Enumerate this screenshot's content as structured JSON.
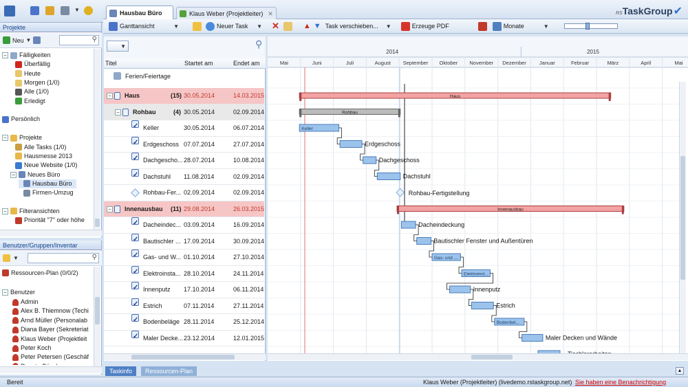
{
  "tabs": [
    {
      "label": "Hausbau Büro",
      "active": true
    },
    {
      "label": "Klaus Weber (Projektleiter)",
      "active": false
    }
  ],
  "brand": {
    "prefix": "RS",
    "name": "TaskGroup"
  },
  "toolbar": {
    "gantt_view": "Ganttansicht",
    "new_task": "Neuer Task",
    "move_task": "Task verschieben...",
    "pdf": "Erzeuge PDF",
    "scale": "Monate"
  },
  "left": {
    "projects_title": "Projekte",
    "new_label": "Neu",
    "tree": [
      {
        "label": "Fälligkeiten",
        "level": 0,
        "exp": "−",
        "icon": "calendar-icon"
      },
      {
        "label": "Überfällig",
        "level": 1,
        "icon": "exclamation-icon"
      },
      {
        "label": "Heute",
        "level": 1,
        "icon": "day-icon"
      },
      {
        "label": "Morgen (1/0)",
        "level": 1,
        "icon": "day-icon"
      },
      {
        "label": "Alle (1/0)",
        "level": 1,
        "icon": "sigma-icon"
      },
      {
        "label": "Erledigt",
        "level": 1,
        "icon": "check-icon"
      },
      {
        "label": "",
        "level": 0
      },
      {
        "label": "Persönlich",
        "level": 0,
        "icon": "person-icon"
      },
      {
        "label": "",
        "level": 0
      },
      {
        "label": "Projekte",
        "level": 0,
        "exp": "−",
        "icon": "folder-icon"
      },
      {
        "label": "Alle Tasks (1/0)",
        "level": 1,
        "icon": "tasks-icon"
      },
      {
        "label": "Hausmesse 2013",
        "level": 1,
        "icon": "folder-icon"
      },
      {
        "label": "Neue Website (1/0)",
        "level": 1,
        "icon": "globe-icon"
      },
      {
        "label": "Neues Büro",
        "level": 1,
        "exp": "−",
        "icon": "building-icon"
      },
      {
        "label": "Hausbau Büro",
        "level": 2,
        "icon": "house-icon",
        "selected": true
      },
      {
        "label": "Firmen-Umzug",
        "level": 2,
        "icon": "truck-icon"
      },
      {
        "label": "",
        "level": 0
      },
      {
        "label": "Filteransichten",
        "level": 0,
        "exp": "−",
        "icon": "filter-icon"
      },
      {
        "label": "Priorität \"7\" oder höhe",
        "level": 1,
        "icon": "priority-icon"
      }
    ],
    "users_title": "Benutzer/Gruppen/Inventar",
    "resource_plan": "Ressourcen-Plan (0/0/2)",
    "users_header": "Benutzer",
    "users": [
      "Admin",
      "Alex B. Thiemnow (Techi",
      "Arnd Müller (Personalab",
      "Diana Bayer (Sekreteriat",
      "Klaus Weber (Projektleit",
      "Peter Koch",
      "Peter Petersen (Geschäf",
      "Renate Büscher"
    ]
  },
  "grid": {
    "col_title": "Titel",
    "col_start": "Startet am",
    "col_end": "Endet am",
    "holidays": "Ferien/Feiertage",
    "rows": [
      {
        "kind": "group",
        "title": "Haus",
        "count": "(15)",
        "start": "30.05.2014",
        "end": "14.03.2015",
        "hl": "red"
      },
      {
        "kind": "group",
        "title": "Rohbau",
        "count": "(4)",
        "start": "30.05.2014",
        "end": "02.09.2014",
        "hl": "gray",
        "indent": 1
      },
      {
        "kind": "task",
        "title": "Keller",
        "start": "30.05.2014",
        "end": "06.07.2014"
      },
      {
        "kind": "task",
        "title": "Erdgeschoss",
        "start": "07.07.2014",
        "end": "27.07.2014"
      },
      {
        "kind": "task",
        "title": "Dachgescho...",
        "start": "28.07.2014",
        "end": "10.08.2014"
      },
      {
        "kind": "task",
        "title": "Dachstuhl",
        "start": "11.08.2014",
        "end": "02.09.2014"
      },
      {
        "kind": "milestone",
        "title": "Rohbau-Fer...",
        "start": "02.09.2014",
        "end": "02.09.2014"
      },
      {
        "kind": "group",
        "title": "Innenausbau",
        "count": "(11)",
        "start": "29.08.2014",
        "end": "26.03.2015",
        "hl": "red"
      },
      {
        "kind": "task",
        "title": "Dacheindec...",
        "start": "03.09.2014",
        "end": "16.09.2014"
      },
      {
        "kind": "task",
        "title": "Bautischler ...",
        "start": "17.09.2014",
        "end": "30.09.2014"
      },
      {
        "kind": "task",
        "title": "Gas- und W...",
        "start": "01.10.2014",
        "end": "27.10.2014"
      },
      {
        "kind": "task",
        "title": "Elektroinsta...",
        "start": "28.10.2014",
        "end": "24.11.2014"
      },
      {
        "kind": "task",
        "title": "Innenputz",
        "start": "17.10.2014",
        "end": "06.11.2014"
      },
      {
        "kind": "task",
        "title": "Estrich",
        "start": "07.11.2014",
        "end": "27.11.2014"
      },
      {
        "kind": "task",
        "title": "Bodenbeläge",
        "start": "28.11.2014",
        "end": "25.12.2014"
      },
      {
        "kind": "task",
        "title": "Maler Decke...",
        "start": "23.12.2014",
        "end": "12.01.2015"
      }
    ]
  },
  "gantt": {
    "years": [
      "2014",
      "2015"
    ],
    "months": [
      "Mai",
      "Juni",
      "Juli",
      "August",
      "September",
      "Oktober",
      "November",
      "Dezember",
      "Januar",
      "Februar",
      "März",
      "April",
      "Mai"
    ],
    "labels": {
      "haus": "Haus",
      "rohbau": "Rohbau",
      "keller": "Keller",
      "erdgeschoss": "Erdgeschoss",
      "dachgeschoss": "Dachgeschoss",
      "dachstuhl": "Dachstuhl",
      "milestone": "Rohbau-Fertigstellung",
      "innenausbau": "Innenausbau",
      "dacheindeckung": "Dacheindeckung",
      "bautischler": "Bautischler Fenster und Außentüren",
      "gas": "Gas- und ...",
      "elektro": "Elektroinst...",
      "innenputz": "Innenputz",
      "estrich": "Estrich",
      "boden": "Bodenbel...",
      "maler": "Maler Decken und Wände",
      "tischler": "Tischlerarbeiten"
    }
  },
  "bottom_tabs": [
    "Taskinfo",
    "Ressourcen-Plan"
  ],
  "status": {
    "left": "Bereit",
    "user": "Klaus Weber (Projektleiter) (livedemo.rstaskgroup.net)",
    "notify": "Sie haben eine Benachrichtigung"
  },
  "colors": {
    "accent": "#15428b",
    "group_red": "#f6c6c6",
    "bar_blue": "#7fb1e3",
    "notify": "#d40000"
  }
}
